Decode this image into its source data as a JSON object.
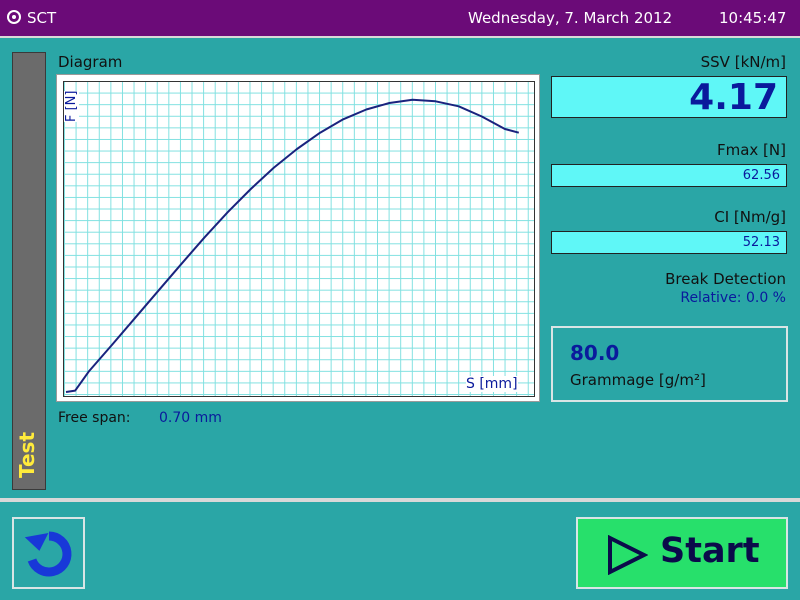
{
  "titlebar": {
    "app_title": "SCT",
    "date": "Wednesday, 7. March 2012",
    "time": "10:45:47",
    "icon": "radio-dot-icon"
  },
  "side_tab": {
    "label": "Test"
  },
  "diagram": {
    "title": "Diagram",
    "y_axis_label": "F [N]",
    "x_axis_label": "S [mm]",
    "free_span_label": "Free span:",
    "free_span_value": "0.70 mm"
  },
  "chart_data": {
    "type": "line",
    "series": [
      {
        "values": [
          [
            0.0,
            0.0
          ],
          [
            0.02,
            0.3
          ],
          [
            0.05,
            4.5
          ],
          [
            0.1,
            10.2
          ],
          [
            0.15,
            16.0
          ],
          [
            0.2,
            21.8
          ],
          [
            0.25,
            27.6
          ],
          [
            0.3,
            33.3
          ],
          [
            0.35,
            38.7
          ],
          [
            0.4,
            43.7
          ],
          [
            0.45,
            48.3
          ],
          [
            0.5,
            52.3
          ],
          [
            0.55,
            55.8
          ],
          [
            0.6,
            58.7
          ],
          [
            0.65,
            60.8
          ],
          [
            0.7,
            62.2
          ],
          [
            0.75,
            62.9
          ],
          [
            0.8,
            62.56
          ],
          [
            0.85,
            61.5
          ],
          [
            0.9,
            59.3
          ],
          [
            0.95,
            56.6
          ],
          [
            0.98,
            55.8
          ]
        ]
      }
    ],
    "xlim": [
      0,
      1
    ],
    "ylim": [
      0,
      65
    ],
    "grid": true,
    "color": "#1a237e",
    "grid_color": "#7fe0e0"
  },
  "results": {
    "ssv_label": "SSV [kN/m]",
    "ssv_value": "4.17",
    "fmax_label": "Fmax [N]",
    "fmax_value": "62.56",
    "ci_label": "CI [Nm/g]",
    "ci_value": "52.13",
    "break_label": "Break Detection",
    "relative_text": "Relative: 0.0 %"
  },
  "grammage": {
    "value": "80.0",
    "label": "Grammage [g/m²]"
  },
  "footer": {
    "back_icon": "refresh-back-icon",
    "start_label": "Start",
    "start_icon": "play-outline-icon",
    "start_color": "#27e06b"
  }
}
